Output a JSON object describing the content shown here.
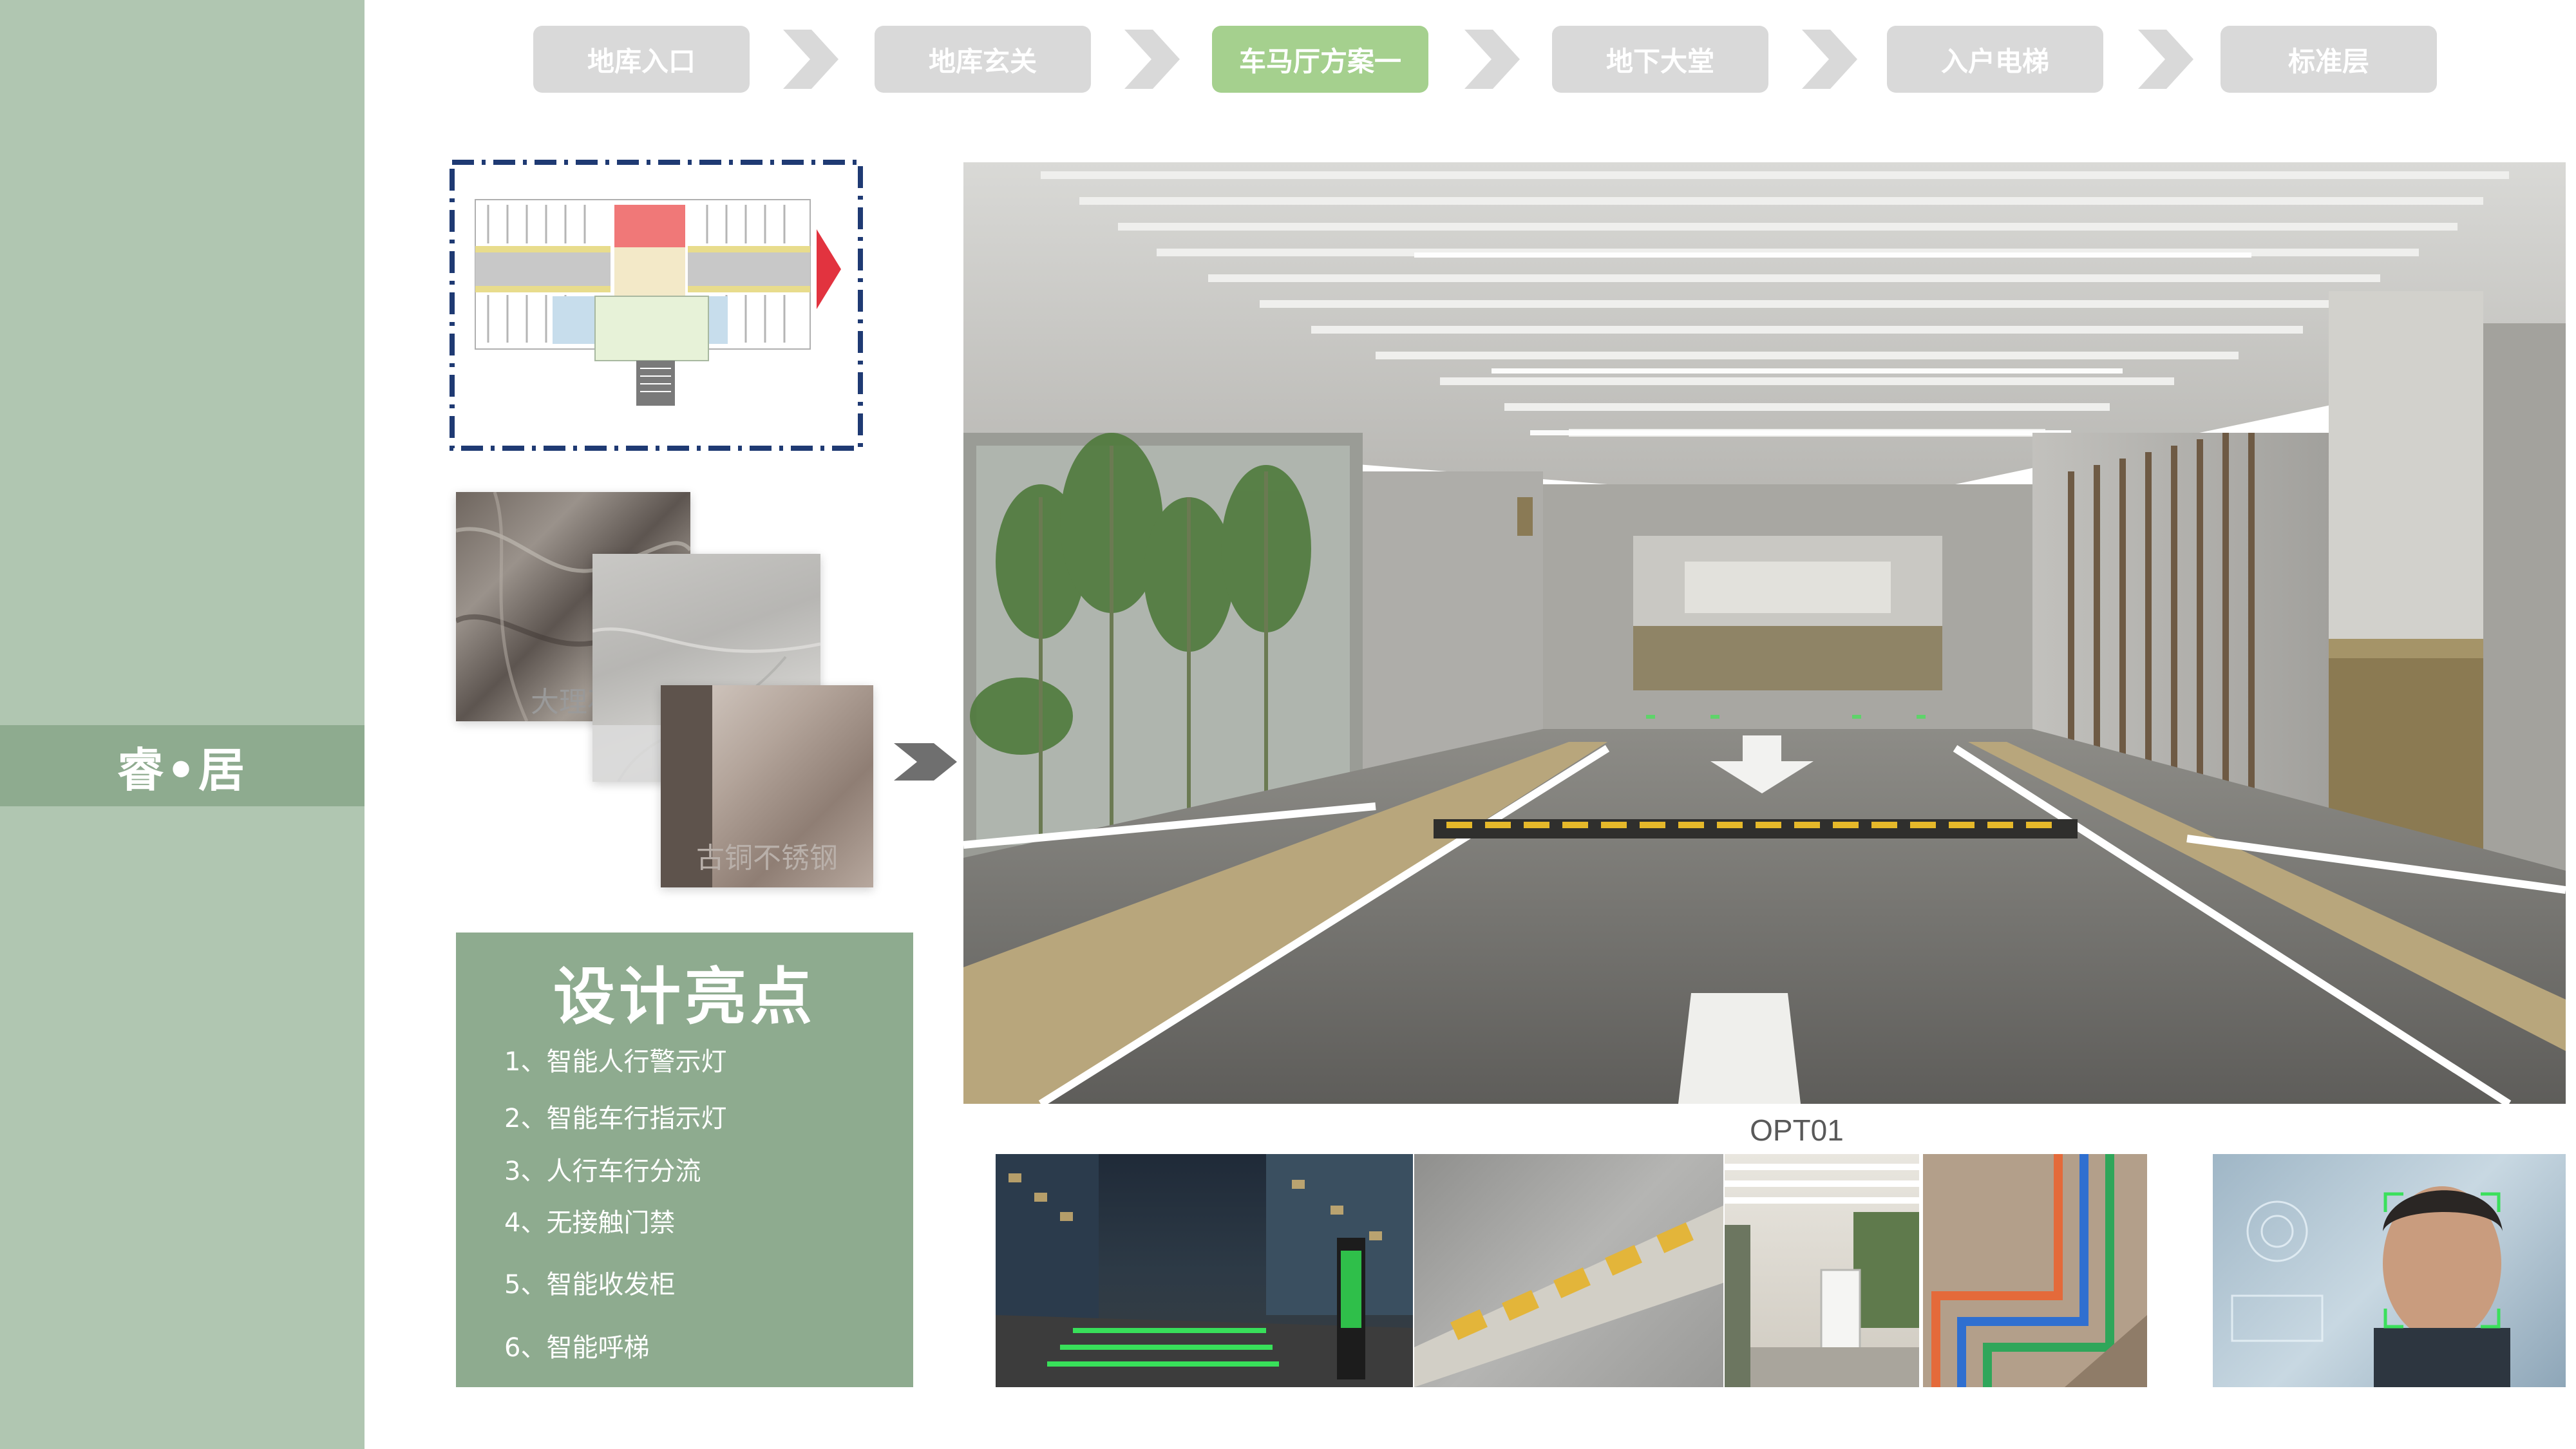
{
  "sidebar": {
    "brand": "睿•居"
  },
  "nav": {
    "steps": [
      {
        "label": "地库入口",
        "active": false
      },
      {
        "label": "地库玄关",
        "active": false
      },
      {
        "label": "车马厅方案一",
        "active": true
      },
      {
        "label": "地下大堂",
        "active": false
      },
      {
        "label": "入户电梯",
        "active": false
      },
      {
        "label": "标准层",
        "active": false
      }
    ]
  },
  "materials": {
    "items": [
      {
        "label": "大理石"
      },
      {
        "label": "大理石"
      },
      {
        "label": "古铜不锈钢"
      }
    ]
  },
  "highlights": {
    "title": "设计亮点",
    "items": [
      "1、智能人行警示灯",
      "2、智能车行指示灯",
      "3、人行车行分流",
      "4、无接触门禁",
      "5、智能收发柜",
      "6、智能呼梯"
    ]
  },
  "render": {
    "caption": "OPT01"
  },
  "colors": {
    "sidebar": "#b0c6b1",
    "brand_band": "#8eab8f",
    "step_inactive": "#d9d9d9",
    "step_active": "#a5d08e",
    "plan_border": "#1f3a73",
    "highlight_panel": "#8eab8f"
  }
}
